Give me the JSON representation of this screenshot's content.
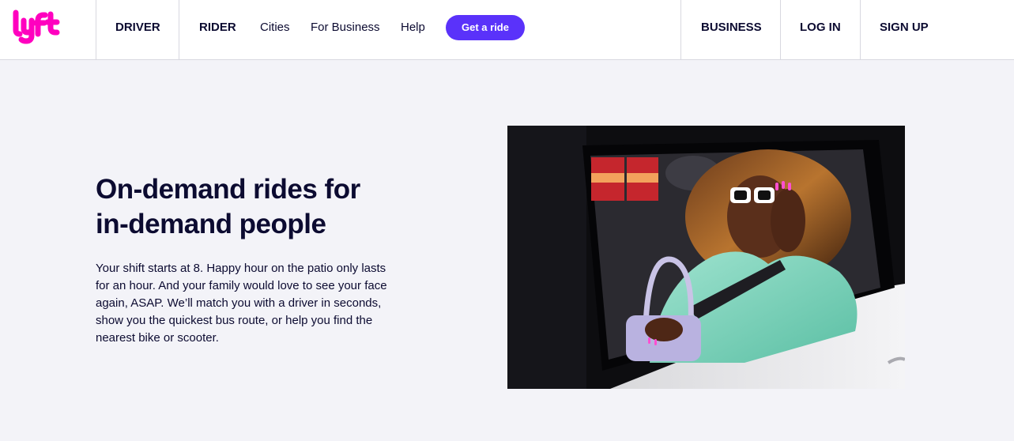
{
  "header": {
    "logo": {
      "text": "lyft",
      "icon": "lyft-logo",
      "color": "#ff00bf"
    },
    "nav_left": [
      {
        "label": "DRIVER",
        "bold": true
      },
      {
        "label": "RIDER",
        "bold": true
      },
      {
        "label": "Cities",
        "bold": false
      },
      {
        "label": "For Business",
        "bold": false
      },
      {
        "label": "Help",
        "bold": false
      }
    ],
    "cta": {
      "label": "Get a ride",
      "color": "#5a32fa"
    },
    "nav_right": [
      {
        "label": "BUSINESS"
      },
      {
        "label": "LOG IN"
      },
      {
        "label": "SIGN UP"
      }
    ]
  },
  "hero": {
    "headline_lines": [
      "On-demand rides for",
      "in-demand people"
    ],
    "body_lines": [
      "Your shift starts at 8. Happy hour on the patio only lasts",
      "for an hour. And your family would love to see your face",
      "again, ASAP. We’ll match you with a driver in seconds,",
      "show you the quickest bus route, or help you find the",
      "nearest bike or scooter."
    ],
    "image": {
      "description_icon": "rider-in-car-photo"
    }
  },
  "colors": {
    "background": "#f3f3f8",
    "text": "#0c0b31",
    "brand_pink": "#ff00bf",
    "accent_purple": "#5a32fa"
  }
}
